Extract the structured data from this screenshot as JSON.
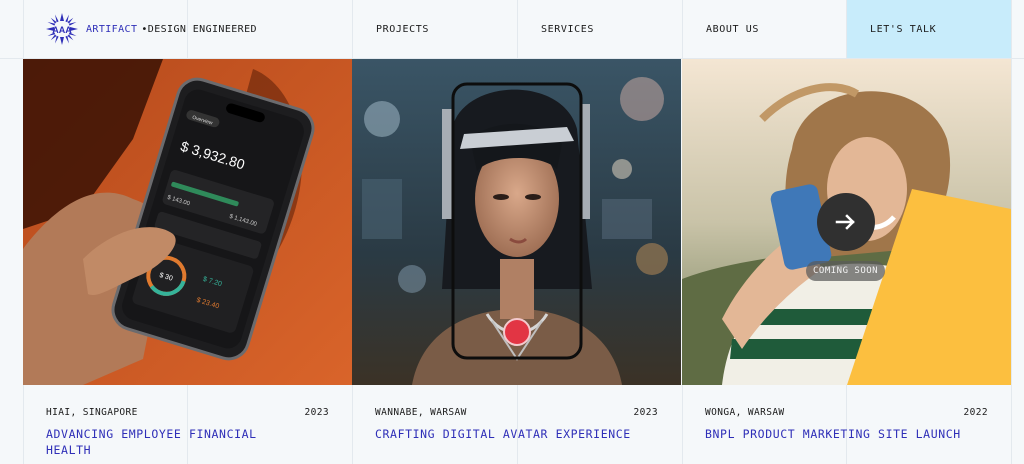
{
  "header": {
    "brand": "ARTIFACT",
    "tagline": "•DESIGN ENGINEERED",
    "nav": [
      {
        "label": "PROJECTS"
      },
      {
        "label": "SERVICES"
      },
      {
        "label": "ABOUT US"
      }
    ],
    "cta_label": "LET'S TALK"
  },
  "colors": {
    "accent": "#2f2fb8",
    "cta_background": "#c8ecfb",
    "page_background": "#f5f8fa"
  },
  "projects": [
    {
      "client": "HIAI, SINGAPORE",
      "year": "2023",
      "title": "ADVANCING EMPLOYEE FINANCIAL HEALTH",
      "phone": {
        "tab": "Overview",
        "balance": "$ 3,932.80",
        "sub_amount": "$ 143.00",
        "sub_amount_2": "$ 1,143.00",
        "ring_value": "$ 30",
        "green_value": "$ 7.20",
        "orange_value": "$ 23.40"
      }
    },
    {
      "client": "WANNABE, WARSAW",
      "year": "2023",
      "title": "CRAFTING DIGITAL AVATAR EXPERIENCE"
    },
    {
      "client": "WONGA, WARSAW",
      "year": "2022",
      "title": "BNPL PRODUCT MARKETING SITE LAUNCH",
      "badge": "COMING SOON",
      "arrow_icon": "arrow-right-icon"
    }
  ]
}
